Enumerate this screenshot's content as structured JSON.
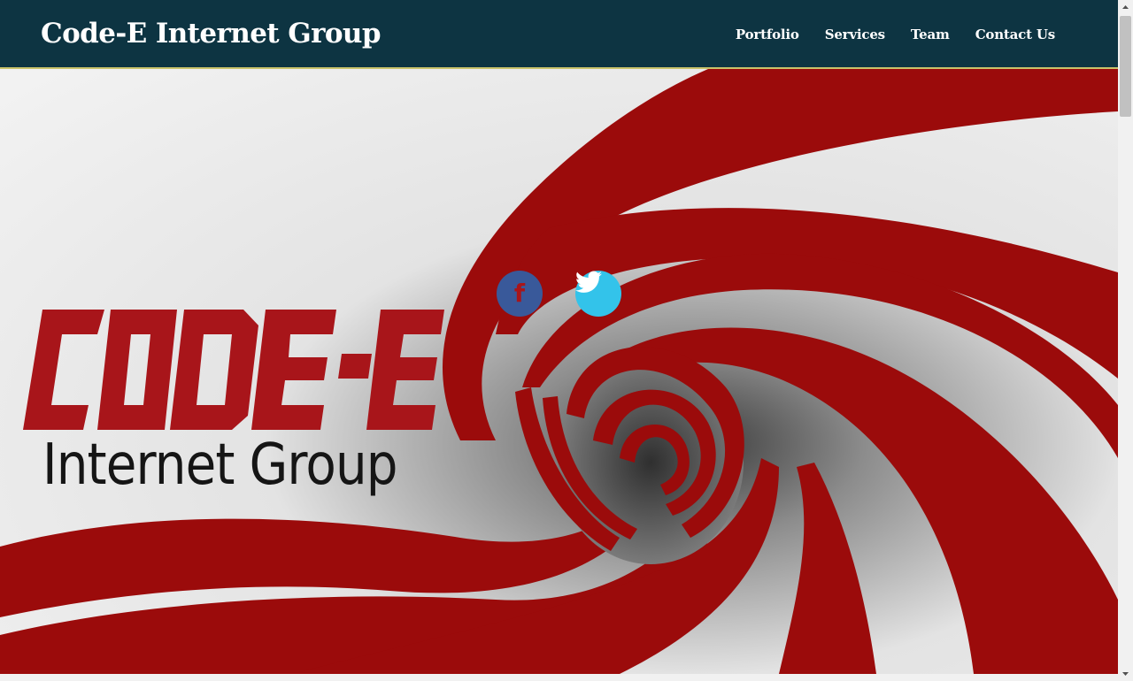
{
  "brand": {
    "name": "Code-E Internet Group"
  },
  "nav": {
    "items": [
      {
        "label": "Portfolio"
      },
      {
        "label": "Services"
      },
      {
        "label": "Team"
      },
      {
        "label": "Contact Us"
      }
    ]
  },
  "hero": {
    "logo": {
      "wordmark": "CODE-E",
      "tagline": "Internet Group"
    },
    "social": [
      {
        "name": "facebook",
        "icon": "facebook-icon",
        "color": "#39599a",
        "glyph": "f"
      },
      {
        "name": "twitter",
        "icon": "twitter-icon",
        "color": "#33c3ea"
      }
    ]
  },
  "colors": {
    "navbar": "#0d3442",
    "accent_red": "#9b0b0b",
    "nav_text": "#ffffff"
  }
}
